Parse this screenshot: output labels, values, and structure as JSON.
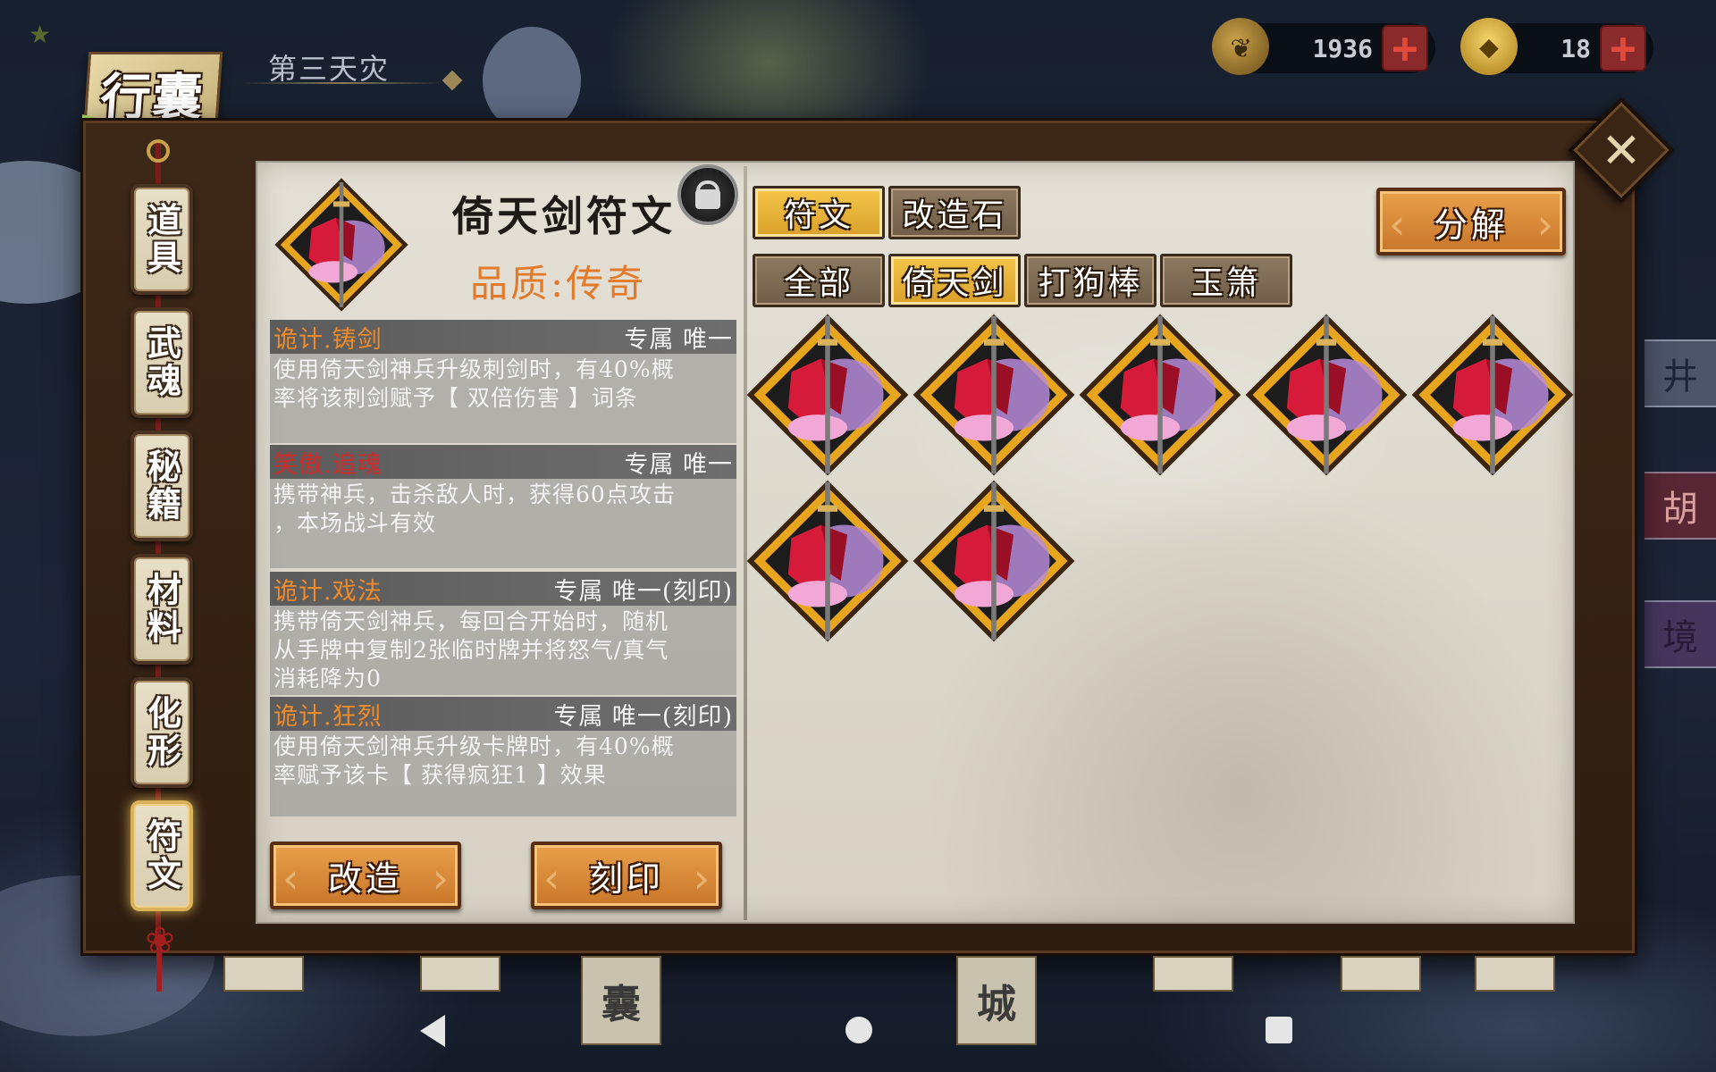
{
  "header": {
    "title": "行囊",
    "calamity": "第三天灾"
  },
  "currencies": [
    {
      "icon": "leaf-icon",
      "value": "1936"
    },
    {
      "icon": "gold-ingot-icon",
      "value": "18"
    }
  ],
  "sidebar": {
    "tabs": [
      {
        "label": "道具",
        "active": false
      },
      {
        "label": "武魂",
        "active": false
      },
      {
        "label": "秘籍",
        "active": false
      },
      {
        "label": "材料",
        "active": false
      },
      {
        "label": "化形",
        "active": false
      },
      {
        "label": "符文",
        "active": true
      }
    ]
  },
  "detail": {
    "name": "倚天剑符文",
    "quality": "品质:传奇",
    "entries": [
      {
        "name": "诡计.铸剑",
        "tag": "专属 唯一",
        "desc_lines": [
          "使用倚天剑神兵升级刺剑时，有40%概",
          "率将该刺剑赋予【 双倍伤害 】词条"
        ]
      },
      {
        "name": "笑傲.追魂",
        "tag": "专属 唯一",
        "desc_lines": [
          "携带神兵，击杀敌人时，获得60点攻击",
          "，本场战斗有效"
        ]
      },
      {
        "name": "诡计.戏法",
        "tag": "专属 唯一(刻印)",
        "desc_lines": [
          "携带倚天剑神兵，每回合开始时，随机",
          "从手牌中复制2张临时牌并将怒气/真气",
          "消耗降为0"
        ]
      },
      {
        "name": "诡计.狂烈",
        "tag": "专属 唯一(刻印)",
        "desc_lines": [
          "使用倚天剑神兵升级卡牌时，有40%概",
          "率赋予该卡【 获得疯狂1 】效果"
        ]
      }
    ],
    "buttons": {
      "modify": "改造",
      "engrave": "刻印"
    }
  },
  "category_tabs": [
    {
      "label": "符文",
      "active": true
    },
    {
      "label": "改造石",
      "active": false
    }
  ],
  "filter_tabs": [
    {
      "label": "全部",
      "active": false
    },
    {
      "label": "倚天剑",
      "active": true
    },
    {
      "label": "打狗棒",
      "active": false
    },
    {
      "label": "玉箫",
      "active": false
    }
  ],
  "decompose_label": "分解",
  "rune_grid": {
    "count": 7
  },
  "dock": {
    "tall1": "囊",
    "tall2": "城"
  },
  "side_strips": [
    "井",
    "胡",
    "境"
  ],
  "colors": {
    "quality": "#e37a2a",
    "entry_name": "#f08a2a",
    "entry_name_alt": "#d42a2a",
    "active_chip": "#f4c64a"
  }
}
